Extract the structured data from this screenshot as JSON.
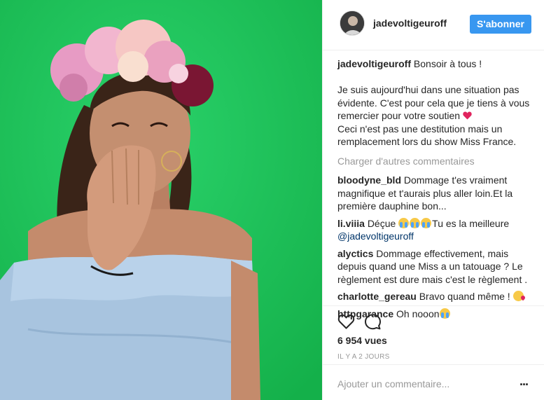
{
  "post": {
    "image_alt": "Portrait photo in front of a green wall"
  },
  "header": {
    "username": "jadevoltigeuroff",
    "follow_label": "S'abonner"
  },
  "caption": {
    "username": "jadevoltigeuroff",
    "line1": "Bonsoir à tous !",
    "line2": "Je suis aujourd'hui dans une situation pas évidente. C'est pour cela que je tiens à vous remercier pour votre soutien",
    "line3": "Ceci n'est pas une destitution mais un remplacement lors du show Miss France."
  },
  "load_more_label": "Charger d'autres commentaires",
  "comments": [
    {
      "username": "bloodyne_bld",
      "text": "Dommage t'es vraiment magnifique et t'aurais plus aller loin.Et la première dauphine bon..."
    },
    {
      "username": "li.viiia",
      "text_before": "Déçue",
      "text_after": "Tu es la meilleure",
      "mention": "@jadevoltigeuroff"
    },
    {
      "username": "alyctics",
      "text": "Dommage effectivement, mais depuis quand une Miss a un tatouage ? Le règlement est dure mais c'est le règlement ."
    },
    {
      "username": "charlotte_gereau",
      "text": "Bravo quand même !"
    },
    {
      "username": "httpgarance",
      "text": "Oh nooon"
    }
  ],
  "stats": {
    "views": "6 954 vues",
    "time": "IL Y A 2 JOURS"
  },
  "composer": {
    "placeholder": "Ajouter un commentaire...",
    "more_label": "..."
  },
  "colors": {
    "background_green": "#1ec25a",
    "follow_blue": "#3897f0",
    "mention_blue": "#003569",
    "muted_gray": "#999999"
  }
}
